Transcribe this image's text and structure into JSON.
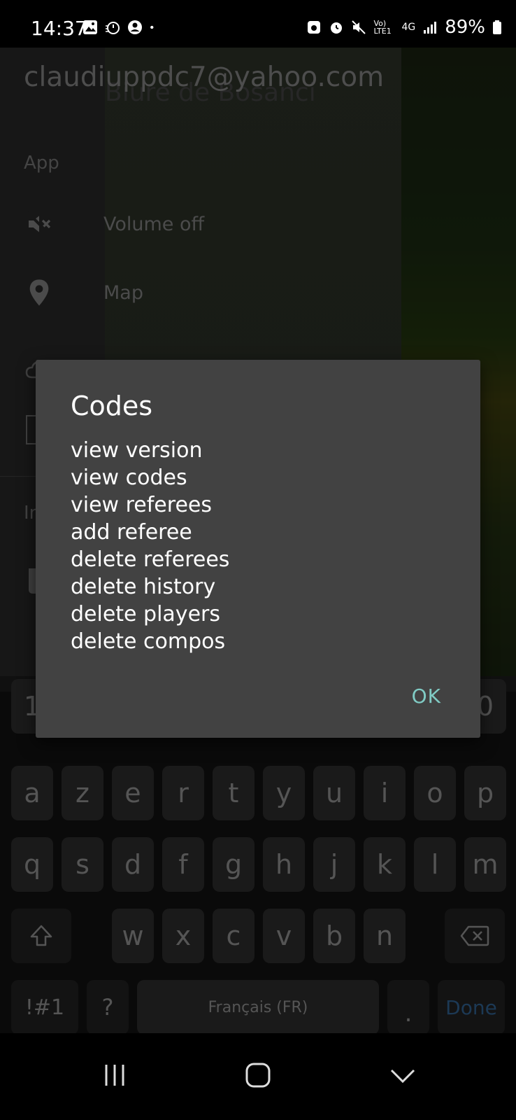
{
  "status_bar": {
    "time": "14:37",
    "battery": "89%",
    "network": "4G",
    "volte": "Vo) LTE1",
    "icons_left": [
      "gallery-icon",
      "timer-icon",
      "account-icon",
      "dot-icon"
    ],
    "icons_right": [
      "lock-icon",
      "alarm-icon",
      "mute-icon",
      "volte-icon",
      "signal-icon",
      "battery-icon"
    ]
  },
  "drawer": {
    "email": "claudiuppdc7@yahoo.com",
    "ghost_title": "Biure de Bosanci",
    "section_app": "App",
    "items": [
      {
        "label": "Volume off",
        "icon": "volume-off-icon"
      },
      {
        "label": "Map",
        "icon": "map-pin-icon"
      }
    ],
    "section_partial": "In"
  },
  "dialog": {
    "title": "Codes",
    "lines": [
      "view version",
      "view codes",
      "view referees",
      "add referee",
      "delete referees",
      "delete history",
      "delete players",
      "delete compos"
    ],
    "ok_label": "OK"
  },
  "keyboard": {
    "number_row_left": "1",
    "number_row_right": "0",
    "row1": [
      "a",
      "z",
      "e",
      "r",
      "t",
      "y",
      "u",
      "i",
      "o",
      "p"
    ],
    "row2": [
      "q",
      "s",
      "d",
      "f",
      "g",
      "h",
      "j",
      "k",
      "l",
      "m"
    ],
    "row3": [
      "w",
      "x",
      "c",
      "v",
      "b",
      "n"
    ],
    "symbols_label": "!#1",
    "question_label": "?",
    "space_label": "Français (FR)",
    "period_label": ".",
    "done_label": "Done"
  },
  "colors": {
    "dialog_bg": "#424242",
    "ok_accent": "#80cbc4",
    "done_accent": "#2e5d8a"
  }
}
